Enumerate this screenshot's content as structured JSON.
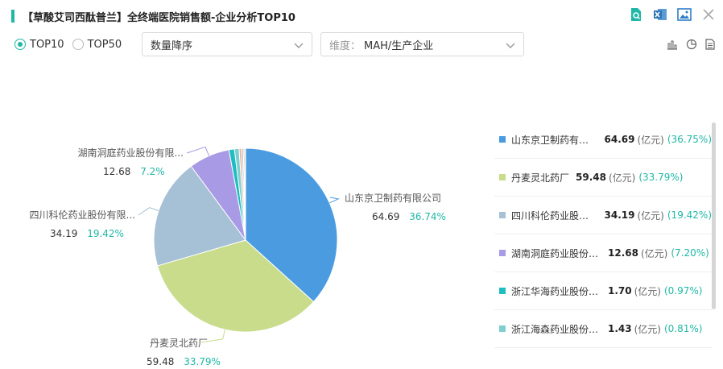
{
  "header": {
    "title": "【草酸艾司西酞普兰】全终端医院销售额-企业分析TOP10"
  },
  "controls": {
    "top10_label": "TOP10",
    "top50_label": "TOP50",
    "selected": "TOP10",
    "sort_value": "数量降序",
    "dimension_prefix": "维度：",
    "dimension_value": "MAH/生产企业"
  },
  "colors": {
    "accent": "#1fb8a6",
    "slices": [
      "#4a9be0",
      "#c8dc8c",
      "#a6c0d6",
      "#a99ae6",
      "#1fbcc0",
      "#7fcfd0",
      "#e6b8a2",
      "#9fb5d9",
      "#c9a27e",
      "#f2cf6a"
    ]
  },
  "chart_data": {
    "type": "pie",
    "unit": "(亿元)",
    "slices": [
      {
        "name": "山东京卫制药有限公司",
        "value": 64.69,
        "percent": "36.74%",
        "legend_percent": "(36.75%)"
      },
      {
        "name": "丹麦灵北药厂",
        "value": 59.48,
        "percent": "33.79%",
        "legend_percent": "(33.79%)"
      },
      {
        "name": "四川科伦药业股份有限公司",
        "value": 34.19,
        "percent": "19.42%",
        "legend_percent": "(19.42%)"
      },
      {
        "name": "湖南洞庭药业股份有限公司",
        "value": 12.68,
        "percent": "7.2%",
        "legend_percent": "(7.20%)"
      },
      {
        "name": "浙江华海药业股份有限公司",
        "value": 1.7,
        "percent": "0.97%",
        "legend_percent": "(0.97%)"
      },
      {
        "name": "浙江海森药业股份有限公司",
        "value": 1.43,
        "percent": "0.81%",
        "legend_percent": "(0.81%)"
      },
      {
        "name": "",
        "value": 0.8
      },
      {
        "name": "",
        "value": 0.5
      },
      {
        "name": "",
        "value": 0.4
      },
      {
        "name": "",
        "value": 0.3
      }
    ],
    "labels": [
      {
        "name": "山东京卫制药有限公司",
        "value": "64.69",
        "percent": "36.74%"
      },
      {
        "name": "丹麦灵北药厂",
        "value": "59.48",
        "percent": "33.79%"
      },
      {
        "name": "四川科伦药业股份有限...",
        "value": "34.19",
        "percent": "19.42%"
      },
      {
        "name": "湖南洞庭药业股份有限...",
        "value": "12.68",
        "percent": "7.2%"
      }
    ],
    "legend": [
      {
        "name": "山东京卫制药有限…",
        "value": "64.69",
        "percent": "(36.75%)"
      },
      {
        "name": "丹麦灵北药厂",
        "value": "59.48",
        "percent": "(33.79%)"
      },
      {
        "name": "四川科伦药业股份…",
        "value": "34.19",
        "percent": "(19.42%)"
      },
      {
        "name": "湖南洞庭药业股份有…",
        "value": "12.68",
        "percent": "(7.20%)"
      },
      {
        "name": "浙江华海药业股份有…",
        "value": "1.70",
        "percent": "(0.97%)"
      },
      {
        "name": "浙江海森药业股份有…",
        "value": "1.43",
        "percent": "(0.81%)"
      }
    ],
    "legend_unit": "(亿元)",
    "legend_placement": "right"
  }
}
